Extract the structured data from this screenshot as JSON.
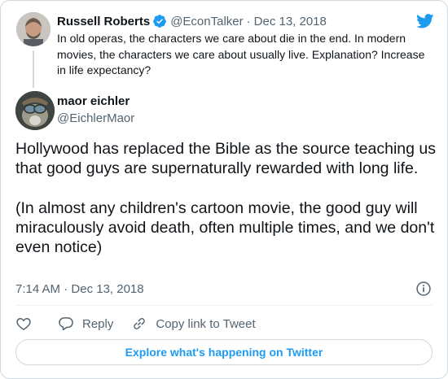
{
  "parent_tweet": {
    "author_name": "Russell Roberts",
    "author_handle": "@EconTalker",
    "separator": "·",
    "date": "Dec 13, 2018",
    "text": "In old operas, the characters we care about die in the end. In modern movies, the characters we care about usually live. Explanation? Increase in life expectancy?",
    "verified": true
  },
  "tweet": {
    "author_name": "maor eichler",
    "author_handle": "@EichlerMaor",
    "text": "Hollywood has replaced the Bible as the source teaching us that good guys are supernaturally rewarded with long life.\n\n(In almost any children's cartoon movie, the good guy will miraculously avoid death, often multiple times, and we don't even notice)",
    "time": "7:14 AM",
    "separator": "·",
    "date": "Dec 13, 2018"
  },
  "actions": {
    "like_icon": "heart-icon",
    "reply_label": "Reply",
    "reply_icon": "speech-bubble-icon",
    "copy_link_label": "Copy link to Tweet",
    "copy_link_icon": "link-icon"
  },
  "explore_button_label": "Explore what's happening on Twitter",
  "icons": {
    "brand": "twitter-bird-icon",
    "verified": "verified-badge-icon",
    "info": "info-icon"
  },
  "colors": {
    "brand_blue": "#1d9bf0",
    "text_primary": "#0f1419",
    "text_secondary": "#536471",
    "border": "#cfd9de"
  }
}
